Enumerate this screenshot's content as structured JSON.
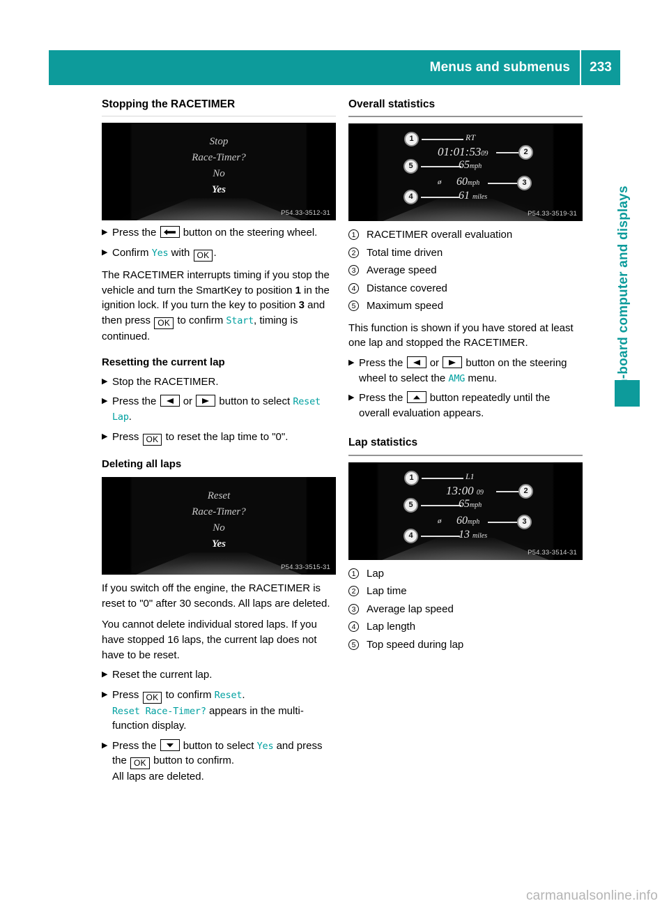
{
  "header": {
    "title": "Menus and submenus",
    "page_number": "233"
  },
  "side_tab": {
    "label": "On-board computer and displays"
  },
  "watermark": {
    "text": "carmanualsonline.info"
  },
  "left_column": {
    "section_title": "Stopping the RACETIMER",
    "screen_stop": {
      "line1": "Stop",
      "line2": "Race-Timer?",
      "line3": "No",
      "line4": "Yes",
      "image_code": "P54.33-3512-31"
    },
    "step_press_back_1": "Press the",
    "step_press_back_2": "button on the steering wheel.",
    "key_back": "back-button",
    "step_confirm_1": "Confirm",
    "step_confirm_term": "Yes",
    "step_confirm_2": "with",
    "key_ok": "OK",
    "step_confirm_end": ".",
    "para_interrupt_a": "The RACETIMER interrupts timing if you stop the vehicle and turn the SmartKey to position ",
    "para_interrupt_pos1": "1",
    "para_interrupt_b": " in the ignition lock. If you turn the key to position ",
    "para_interrupt_pos3": "3",
    "para_interrupt_c": " and then press ",
    "para_interrupt_d": " to confirm ",
    "para_interrupt_term": "Start",
    "para_interrupt_e": ", timing is continued.",
    "sub_reset_lap": "Resetting the current lap",
    "step_stop_racetimer": "Stop the RACETIMER.",
    "step_select_1": "Press the",
    "step_select_or": "or",
    "step_select_2": "button to select",
    "step_select_term": "Reset Lap",
    "step_select_end": ".",
    "step_reset_1": "Press",
    "step_reset_2": "to reset the lap time to \"0\".",
    "sub_delete_laps": "Deleting all laps",
    "screen_reset": {
      "line1": "Reset",
      "line2": "Race-Timer?",
      "line3": "No",
      "line4": "Yes",
      "image_code": "P54.33-3515-31"
    },
    "para_switch_off": "If you switch off the engine, the RACETIMER is reset to \"0\" after 30 seconds. All laps are deleted.",
    "para_cannot_delete": "You cannot delete individual stored laps. If you have stopped 16 laps, the current lap does not have to be reset.",
    "step_reset_current": "Reset the current lap.",
    "step_confirm_reset_1": "Press",
    "step_confirm_reset_2": "to confirm",
    "step_confirm_reset_term": "Reset",
    "step_confirm_reset_end": ".",
    "step_confirm_reset_line2_term": "Reset Race-Timer?",
    "step_confirm_reset_line2": "appears in the multi-function display.",
    "step_yes_1": "Press the",
    "step_yes_2": "button to select",
    "step_yes_term": "Yes",
    "step_yes_3": "and press the",
    "step_yes_4": "button to confirm.",
    "step_yes_line3": "All laps are deleted."
  },
  "right_column": {
    "section_overall": "Overall statistics",
    "screen_overall": {
      "label_rt": "RT",
      "time": "01:01:53",
      "time_frac": "09",
      "max_speed": "65",
      "max_speed_unit": "mph",
      "avg_symbol": "ø",
      "avg_speed": "60",
      "avg_speed_unit": "mph",
      "distance": "61",
      "distance_unit": "miles",
      "image_code": "P54.33-3519-31"
    },
    "legend_overall": [
      {
        "num": "1",
        "label": "RACETIMER overall evaluation"
      },
      {
        "num": "2",
        "label": "Total time driven"
      },
      {
        "num": "3",
        "label": "Average speed"
      },
      {
        "num": "4",
        "label": "Distance covered"
      },
      {
        "num": "5",
        "label": "Maximum speed"
      }
    ],
    "para_function_shown": "This function is shown if you have stored at least one lap and stopped the RACETIMER.",
    "step_amg_1": "Press the",
    "step_amg_or": "or",
    "step_amg_2": "button on the steering wheel to select the",
    "step_amg_term": "AMG",
    "step_amg_3": "menu.",
    "step_up_1": "Press the",
    "step_up_2": "button repeatedly until the overall evaluation appears.",
    "section_lap": "Lap statistics",
    "screen_lap": {
      "label_lap": "L1",
      "time": "13:00",
      "time_frac": "09",
      "max_speed": "65",
      "max_speed_unit": "mph",
      "avg_symbol": "ø",
      "avg_speed": "60",
      "avg_speed_unit": "mph",
      "distance": "13",
      "distance_unit": "miles",
      "image_code": "P54.33-3514-31"
    },
    "legend_lap": [
      {
        "num": "1",
        "label": "Lap"
      },
      {
        "num": "2",
        "label": "Lap time"
      },
      {
        "num": "3",
        "label": "Average lap speed"
      },
      {
        "num": "4",
        "label": "Lap length"
      },
      {
        "num": "5",
        "label": "Top speed during lap"
      }
    ]
  }
}
